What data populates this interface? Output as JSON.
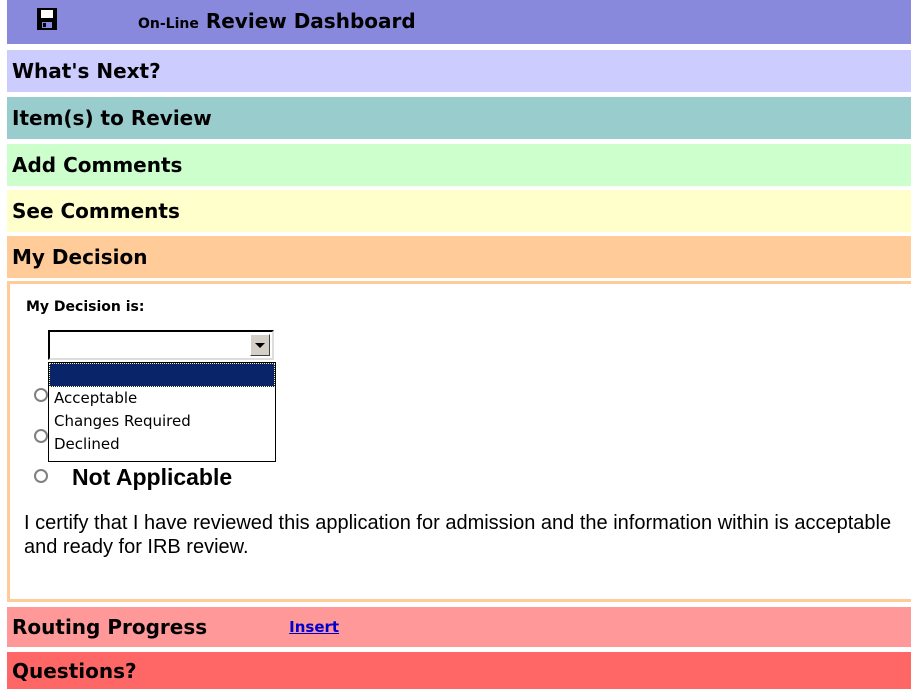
{
  "header": {
    "prefix": "On-Line",
    "title": "Review Dashboard",
    "save_icon": "floppy-disk-icon"
  },
  "sections": {
    "whats_next": "What's Next?",
    "items_to_review": "Item(s) to Review",
    "add_comments": "Add Comments",
    "see_comments": "See Comments",
    "my_decision": "My Decision",
    "routing_progress": "Routing Progress",
    "routing_link": "Insert",
    "questions": "Questions?"
  },
  "decision": {
    "label": "My Decision is:",
    "selected_value": "",
    "options": [
      "",
      "Acceptable",
      "Changes Required",
      "Declined"
    ],
    "radio_na_label": "Not Applicable",
    "certify_text": "I certify that I have reviewed this application for admission and the information within is acceptable and ready for IRB review."
  },
  "colors": {
    "header": "#8888dd",
    "whats_next": "#ccccff",
    "items_to_review": "#99cccc",
    "add_comments": "#ccffcc",
    "see_comments": "#ffffcc",
    "my_decision": "#ffcc99",
    "routing_progress": "#ff9999",
    "questions": "#ff6666"
  }
}
